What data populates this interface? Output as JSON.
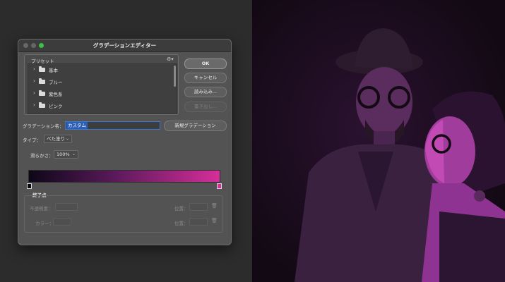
{
  "dialog": {
    "title": "グラデーションエディター",
    "presets": {
      "label": "プリセット",
      "settings_icon": "gear-icon",
      "items": [
        {
          "label": "基本"
        },
        {
          "label": "ブルー"
        },
        {
          "label": "紫色系"
        },
        {
          "label": "ピンク"
        }
      ]
    },
    "buttons": {
      "ok": "OK",
      "cancel": "キャンセル",
      "load": "読み込み...",
      "save": "書き出し..."
    },
    "name_label": "グラデーション名：",
    "name_value": "カスタム",
    "new_button": "新規グラデーション",
    "type_label": "タイプ：",
    "type_value": "べた塗り",
    "smoothness_label": "滑らかさ：",
    "smoothness_value": "100%",
    "gradient": {
      "start_color": "#0d0718",
      "end_color": "#d62e9a"
    },
    "stops": {
      "title": "終了点",
      "opacity_label": "不透明度：",
      "location_label": "位置：",
      "color_label": "カラー：",
      "location_label_2": "位置："
    }
  },
  "photo": {
    "tint": "#d62e9a"
  }
}
